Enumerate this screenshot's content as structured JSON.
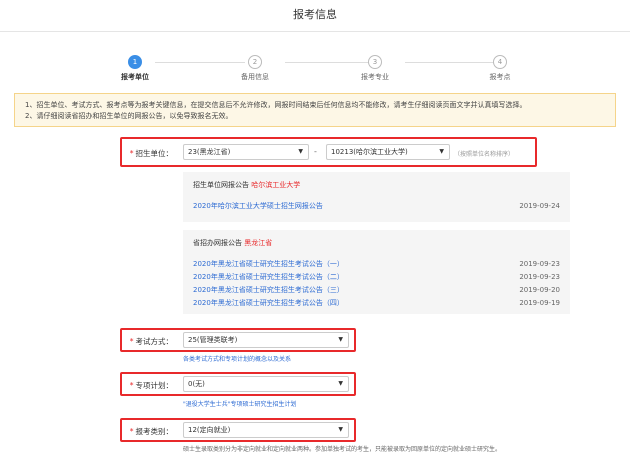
{
  "header": {
    "title": "报考信息"
  },
  "steps": [
    {
      "num": "1",
      "label": "报考单位",
      "active": true
    },
    {
      "num": "2",
      "label": "备用信息",
      "active": false
    },
    {
      "num": "3",
      "label": "报考专业",
      "active": false
    },
    {
      "num": "4",
      "label": "报考点",
      "active": false
    }
  ],
  "notice": {
    "line1": "1、招生单位、考试方式、报考点等为报考关键信息，在提交信息后不允许修改，网报时间结束后任何信息均不能修改，请考生仔细阅读页面文字并认真填写选择。",
    "line2": "2、请仔细阅读省招办和招生单位的网报公告，以免导致报名无效。"
  },
  "unit": {
    "label": "招生单位：",
    "star": "*",
    "province": "23(黑龙江省)",
    "dash": "-",
    "school": "10213(哈尔滨工业大学)",
    "hint": "（按照单位名称排序）"
  },
  "school_notice": {
    "title": "招生单位网报公告",
    "school_name": "哈尔滨工业大学",
    "items": [
      {
        "text": "2020年哈尔滨工业大学硕士招生网报公告",
        "date": "2019-09-24"
      }
    ]
  },
  "province_notice": {
    "title": "省招办网报公告",
    "province_name": "黑龙江省",
    "items": [
      {
        "text": "2020年黑龙江省硕士研究生招生考试公告（一）",
        "date": "2019-09-23"
      },
      {
        "text": "2020年黑龙江省硕士研究生招生考试公告（二）",
        "date": "2019-09-23"
      },
      {
        "text": "2020年黑龙江省硕士研究生招生考试公告（三）",
        "date": "2019-09-20"
      },
      {
        "text": "2020年黑龙江省硕士研究生招生考试公告（四）",
        "date": "2019-09-19"
      }
    ]
  },
  "exam_mode": {
    "label": "考试方式：",
    "star": "*",
    "value": "25(管理类联考)",
    "link": "各类考试方式和专项计划的概念以及关系"
  },
  "special_plan": {
    "label": "专项计划：",
    "star": "*",
    "value": "0(无)",
    "link": "\"退役大学生士兵\"专项硕士研究生招生计划"
  },
  "category": {
    "label": "报考类别：",
    "star": "*",
    "value": "12(定向就业)",
    "note": "硕士生录取类别分为非定向就业和定向就业两种。参加单独考试的考生，只能被录取为回原单位的定向就业硕士研究生。"
  },
  "icons": {
    "caret": "▼"
  }
}
